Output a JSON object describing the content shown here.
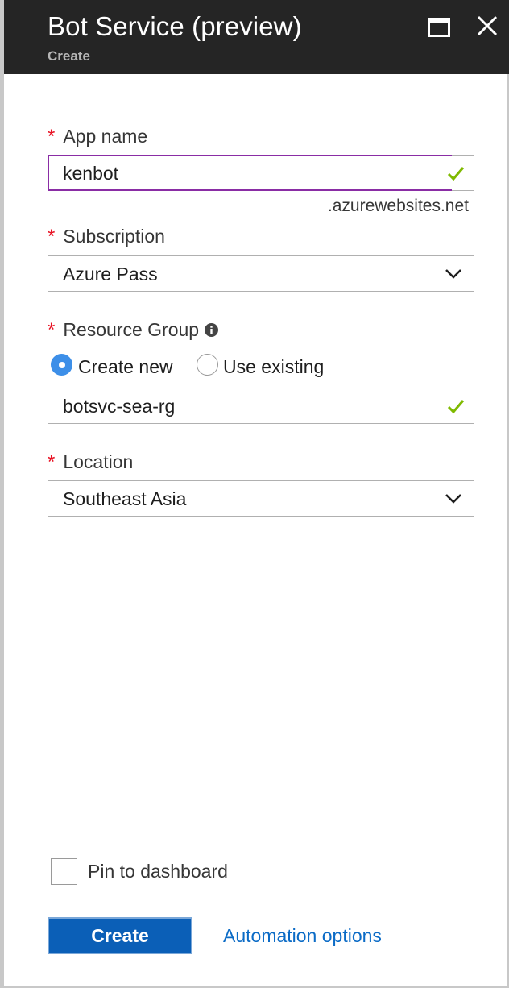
{
  "header": {
    "title": "Bot Service (preview)",
    "subtitle": "Create"
  },
  "form": {
    "required_marker": "*",
    "app_name": {
      "label": "App name",
      "value": "kenbot",
      "suffix": ".azurewebsites.net",
      "valid": true
    },
    "subscription": {
      "label": "Subscription",
      "value": "Azure Pass"
    },
    "resource_group": {
      "label": "Resource Group",
      "options": [
        "Create new",
        "Use existing"
      ],
      "selected": "Create new",
      "value": "botsvc-sea-rg",
      "valid": true
    },
    "location": {
      "label": "Location",
      "value": "Southeast Asia"
    }
  },
  "footer": {
    "pin_label": "Pin to dashboard",
    "pin_checked": false,
    "create_label": "Create",
    "automation_label": "Automation options"
  },
  "colors": {
    "header_bg": "#252525",
    "required": "#e81123",
    "valid_check": "#7fba00",
    "focus_border": "#8a2da5",
    "radio_selected": "#3d8fe8",
    "primary_button": "#0b5fb7",
    "link": "#0b6bc6"
  },
  "icons": {
    "maximize": "maximize-icon",
    "close": "close-icon",
    "check": "checkmark-icon",
    "dropdown": "chevron-down-icon",
    "info": "info-icon"
  }
}
